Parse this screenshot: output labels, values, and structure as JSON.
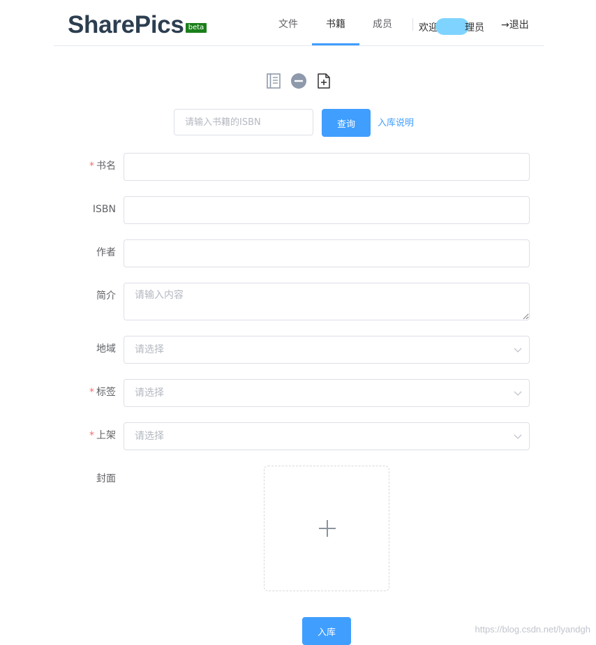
{
  "header": {
    "logo": "SharePics",
    "badge": "beta",
    "nav": [
      "文件",
      "书籍",
      "成员"
    ],
    "active_tab": "书籍",
    "welcome_prefix": "欢迎",
    "welcome_suffix": "理员",
    "logout": "→退出"
  },
  "toolbar": {
    "icons": [
      "book-icon",
      "minus-circle-icon",
      "file-add-icon"
    ],
    "icon_color": "#8e99ab"
  },
  "isbn_search": {
    "placeholder": "请输入书籍的ISBN",
    "query_button": "查询",
    "help_link": "入库说明"
  },
  "form": {
    "title_label": "书名",
    "isbn_label": "ISBN",
    "author_label": "作者",
    "summary_label": "简介",
    "summary_placeholder": "请输入内容",
    "region_label": "地域",
    "region_placeholder": "请选择",
    "tags_label": "标签",
    "tags_placeholder": "请选择",
    "shelf_label": "上架",
    "shelf_placeholder": "请选择",
    "cover_label": "封面",
    "required_mark": "*",
    "submit_button": "入库"
  },
  "watermark": "https://blog.csdn.net/lyandgh",
  "colors": {
    "primary": "#409eff",
    "required": "#f56c6c",
    "logo": "#2c3e50",
    "beta_badge": "#1a7f1a"
  }
}
